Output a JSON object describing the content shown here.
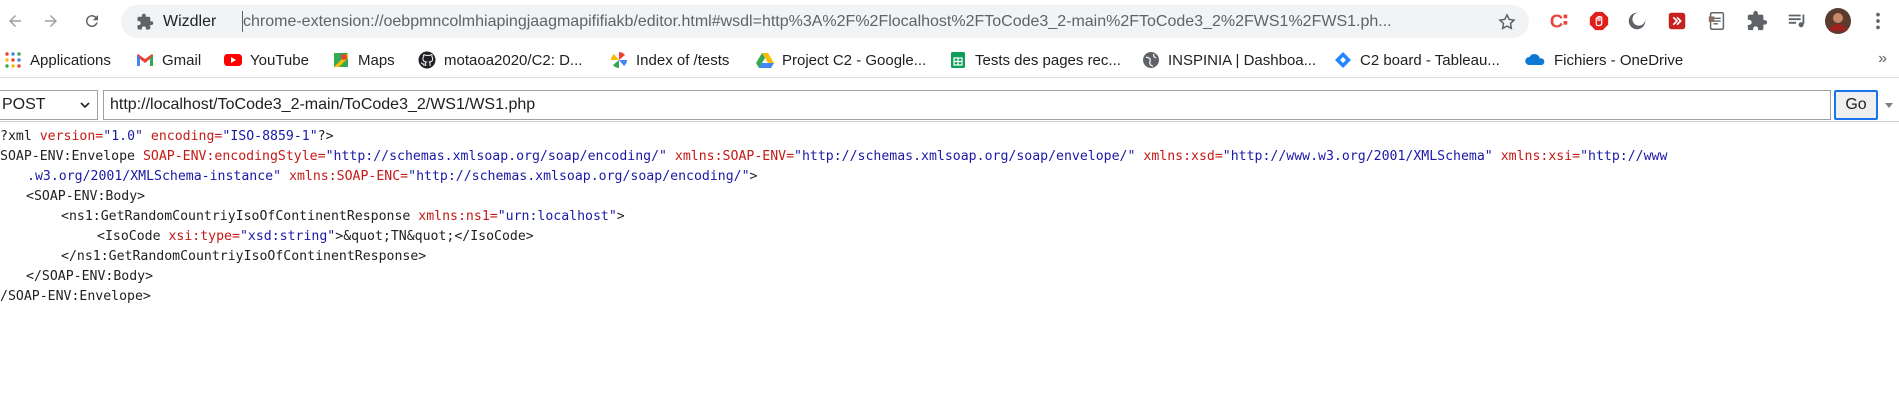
{
  "toolbar": {
    "back_icon": "arrow-left-icon",
    "forward_icon": "arrow-right-icon",
    "reload_icon": "reload-icon",
    "omnibox": {
      "site_name": "Wizdler",
      "url": "chrome-extension://oebpmncolmhiapingjaagmapififiakb/editor.html#wsdl=http%3A%2F%2Flocalhost%2FToCode3_2-main%2FToCode3_2%2FWS1%2FWS1.ph..."
    },
    "extensions": [
      "c-extension-icon",
      "adblock-icon",
      "dark-mode-icon",
      "video-extension-icon",
      "document-extension-icon",
      "puzzle-icon",
      "media-control-icon",
      "avatar"
    ]
  },
  "bookmarks": [
    {
      "label": "Applications",
      "icon": "apps-grid-icon"
    },
    {
      "label": "Gmail",
      "icon": "gmail-icon"
    },
    {
      "label": "YouTube",
      "icon": "youtube-icon"
    },
    {
      "label": "Maps",
      "icon": "maps-icon"
    },
    {
      "label": "motaoa2020/C2: D...",
      "icon": "github-icon"
    },
    {
      "label": "Index of /tests",
      "icon": "pinwheel-icon"
    },
    {
      "label": "Project C2 - Google...",
      "icon": "drive-icon"
    },
    {
      "label": "Tests des pages rec...",
      "icon": "sheets-icon"
    },
    {
      "label": "INSPINIA | Dashboa...",
      "icon": "globe-icon"
    },
    {
      "label": "C2 board - Tableau...",
      "icon": "jira-icon"
    },
    {
      "label": "Fichiers - OneDrive",
      "icon": "onedrive-icon"
    }
  ],
  "bookmarks_more": "»",
  "request": {
    "method": "POST",
    "url": "http://localhost/ToCode3_2-main/ToCode3_2/WS1/WS1.php",
    "go_label": "Go"
  },
  "xml": {
    "decl": {
      "start": "?xml",
      "a1": "version=",
      "v1": "\"1.0\"",
      "a2": "encoding=",
      "v2": "\"ISO-8859-1\"",
      "end": "?>"
    },
    "envelope_tag": "SOAP-ENV:Envelope",
    "env_attrs": [
      {
        "name": "SOAP-ENV:encodingStyle=",
        "value": "\"http://schemas.xmlsoap.org/soap/encoding/\""
      },
      {
        "name": "xmlns:SOAP-ENV=",
        "value": "\"http://schemas.xmlsoap.org/soap/envelope/\""
      },
      {
        "name": "xmlns:xsd=",
        "value": "\"http://www.w3.org/2001/XMLSchema\""
      },
      {
        "name": "xmlns:xsi=",
        "value": "\"http://www"
      }
    ],
    "env_line2": {
      "value_cont": ".w3.org/2001/XMLSchema-instance\"",
      "attr": "xmlns:SOAP-ENC=",
      "value": "\"http://schemas.xmlsoap.org/soap/encoding/\"",
      "close": ">"
    },
    "body_open": "<SOAP-ENV:Body>",
    "resp_open": {
      "tag": "<ns1:GetRandomCountriyIsoOfContinentResponse",
      "attr": "xmlns:ns1=",
      "value": "\"urn:localhost\"",
      "close": ">"
    },
    "iso": {
      "tag": "<IsoCode",
      "attr": "xsi:type=",
      "value": "\"xsd:string\"",
      "close": ">",
      "text": "&quot;TN&quot;",
      "end": "</IsoCode>"
    },
    "resp_close": "</ns1:GetRandomCountriyIsoOfContinentResponse>",
    "body_close": "</SOAP-ENV:Body>",
    "envelope_close": "/SOAP-ENV:Envelope>"
  }
}
